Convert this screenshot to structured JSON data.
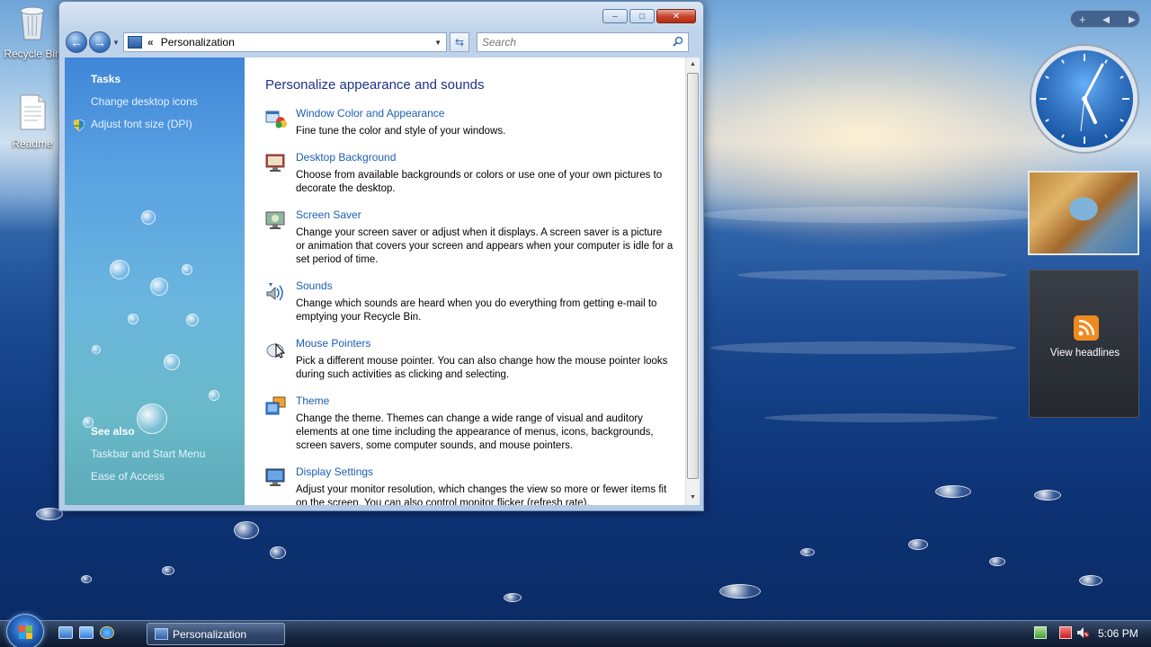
{
  "desktop": {
    "icons": [
      {
        "label": "Recycle Bin"
      },
      {
        "label": "Readme"
      }
    ]
  },
  "window": {
    "title": "Personalization",
    "controls": {
      "minimize": "–",
      "maximize": "□",
      "close": "✕"
    },
    "nav": {
      "back": "←",
      "forward": "→"
    },
    "address": {
      "separator": "«",
      "path": "Personalization"
    },
    "search": {
      "placeholder": "Search"
    },
    "sidebar": {
      "tasks_heading": "Tasks",
      "tasks": [
        "Change desktop icons",
        "Adjust font size (DPI)"
      ],
      "see_also_heading": "See also",
      "see_also": [
        "Taskbar and Start Menu",
        "Ease of Access"
      ]
    },
    "content": {
      "title": "Personalize appearance and sounds",
      "items": [
        {
          "link": "Window Color and Appearance",
          "desc": "Fine tune the color and style of your windows.",
          "icon": "window-color-icon"
        },
        {
          "link": "Desktop Background",
          "desc": "Choose from available backgrounds or colors or use one of your own pictures to decorate the desktop.",
          "icon": "desktop-background-icon"
        },
        {
          "link": "Screen Saver",
          "desc": "Change your screen saver or adjust when it displays. A screen saver is a picture or animation that covers your screen and appears when your computer is idle for a set period of time.",
          "icon": "screen-saver-icon"
        },
        {
          "link": "Sounds",
          "desc": "Change which sounds are heard when you do everything from getting e-mail to emptying your Recycle Bin.",
          "icon": "sounds-icon"
        },
        {
          "link": "Mouse Pointers",
          "desc": "Pick a different mouse pointer. You can also change how the mouse pointer looks during such activities as clicking and selecting.",
          "icon": "mouse-pointers-icon"
        },
        {
          "link": "Theme",
          "desc": "Change the theme. Themes can change a wide range of visual and auditory elements at one time including the appearance of menus, icons, backgrounds, screen savers, some computer sounds, and mouse pointers.",
          "icon": "theme-icon"
        },
        {
          "link": "Display Settings",
          "desc": "Adjust your monitor resolution, which changes the view so more or fewer items fit on the screen. You can also control monitor flicker (refresh rate).",
          "icon": "display-settings-icon"
        }
      ]
    }
  },
  "gadgets": {
    "bar": {
      "add": "+",
      "prev": "◄",
      "next": "►"
    },
    "clock": {
      "time": "5:06"
    },
    "feeds": {
      "label": "View headlines"
    }
  },
  "taskbar": {
    "task_button": "Personalization",
    "clock": "5:06 PM"
  }
}
